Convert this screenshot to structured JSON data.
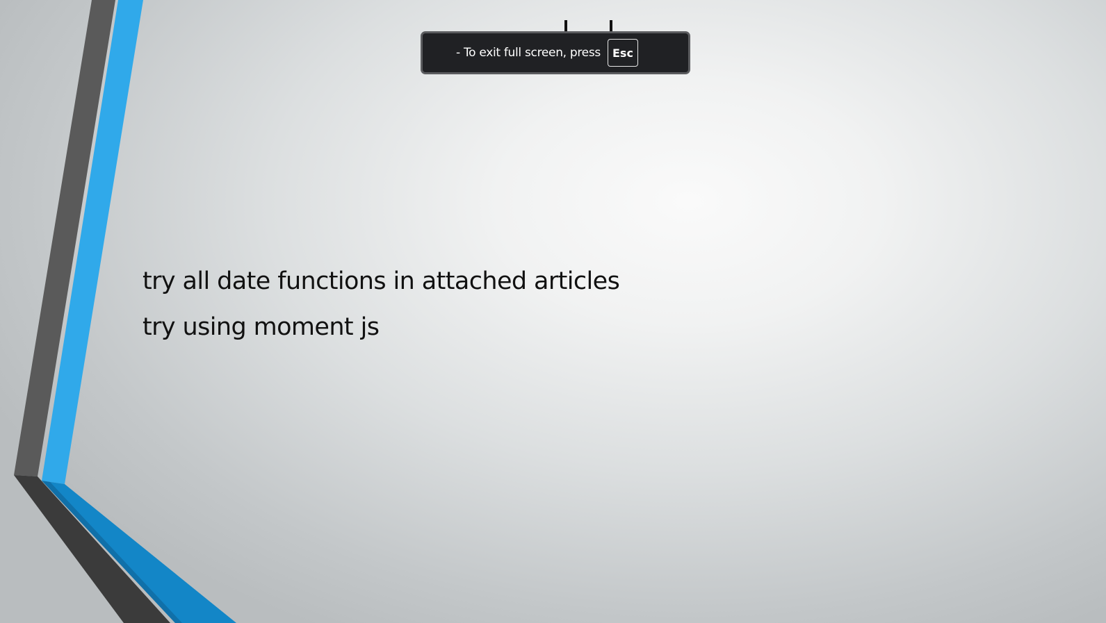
{
  "fullscreen_notice": {
    "message": "-  To exit full screen, press",
    "key_label": "Esc"
  },
  "slide": {
    "lines": [
      "try all date functions in attached articles",
      "try using moment js"
    ]
  },
  "colors": {
    "accent_blue": "#2FA8E8",
    "accent_blue_dark": "#0E7FC0",
    "stripe_gray": "#5A5A5A",
    "stripe_dark": "#3A3A3A",
    "toast_bg": "#202124"
  }
}
